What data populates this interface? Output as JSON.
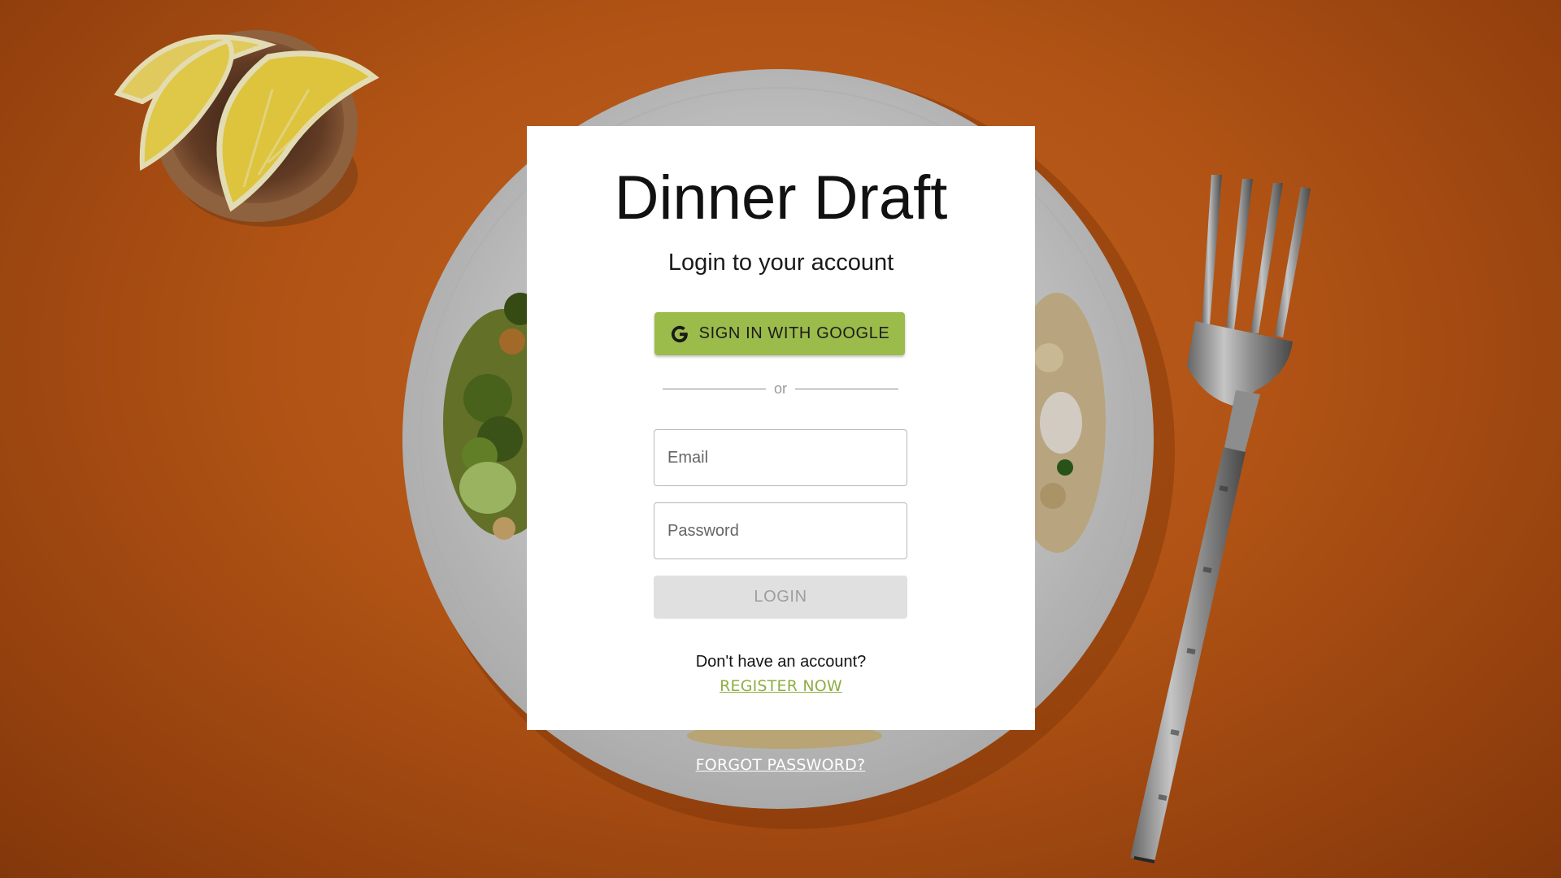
{
  "app": {
    "title": "Dinner Draft",
    "subtitle": "Login to your account"
  },
  "google": {
    "label": "SIGN IN WITH GOOGLE",
    "icon": "google-g-icon"
  },
  "divider": {
    "text": "or"
  },
  "form": {
    "email_placeholder": "Email",
    "password_placeholder": "Password",
    "login_label": "LOGIN",
    "login_enabled": false
  },
  "register": {
    "prompt": "Don't have an account?",
    "link": "REGISTER NOW"
  },
  "forgot": {
    "link": "FORGOT PASSWORD?"
  },
  "colors": {
    "accent_green": "#9bbb4b",
    "link_green": "#8eae42",
    "background_orange": "#c05b17",
    "disabled_gray": "#e0e0e0"
  }
}
